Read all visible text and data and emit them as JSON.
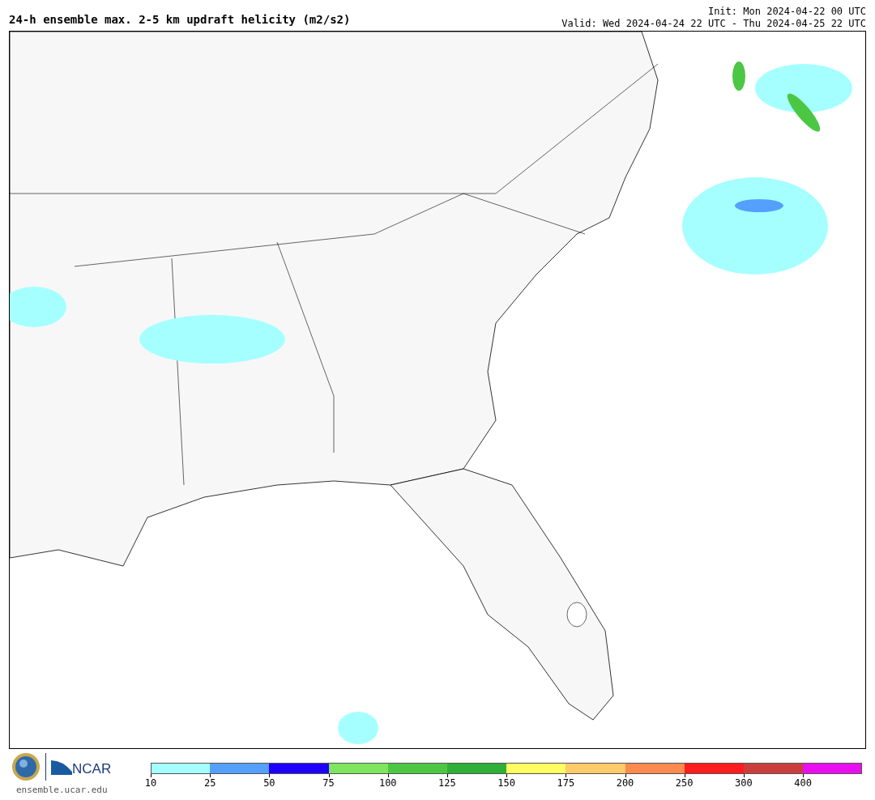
{
  "title": "24-h ensemble max. 2-5 km updraft helicity (m2/s2)",
  "init": "Init: Mon 2024-04-22 00 UTC",
  "valid": "Valid: Wed 2024-04-24 22 UTC - Thu 2024-04-25 22 UTC",
  "logo": {
    "org": "NCAR",
    "url": "ensemble.ucar.edu"
  },
  "colorbar": [
    {
      "label": "10",
      "color": "#a6ffff"
    },
    {
      "label": "25",
      "color": "#559ffd"
    },
    {
      "label": "50",
      "color": "#1e00fc"
    },
    {
      "label": "75",
      "color": "#7fe45e"
    },
    {
      "label": "100",
      "color": "#4cc744"
    },
    {
      "label": "125",
      "color": "#2eb038"
    },
    {
      "label": "150",
      "color": "#fefd62"
    },
    {
      "label": "175",
      "color": "#fdcb68"
    },
    {
      "label": "200",
      "color": "#fd8a4e"
    },
    {
      "label": "250",
      "color": "#fe1c1e"
    },
    {
      "label": "300",
      "color": "#cb3d3d"
    },
    {
      "label": "400",
      "color": "#e90ef0"
    }
  ]
}
